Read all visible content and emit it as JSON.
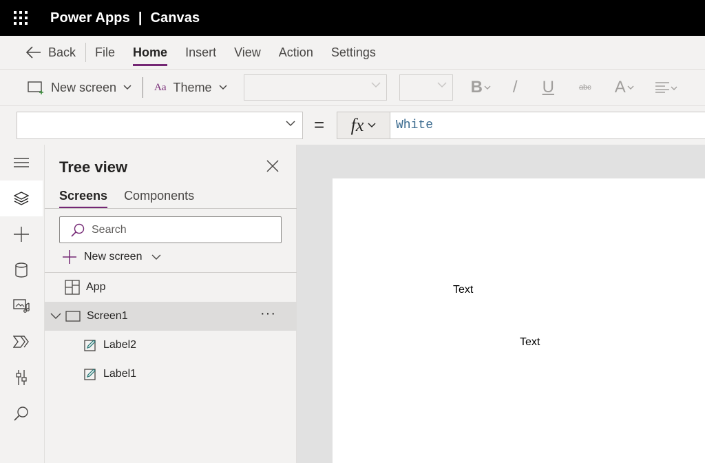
{
  "topbar": {
    "app_name": "Power Apps",
    "separator": "|",
    "app_type": "Canvas"
  },
  "menubar": {
    "back_label": "Back",
    "items": [
      {
        "label": "File",
        "active": false
      },
      {
        "label": "Home",
        "active": true
      },
      {
        "label": "Insert",
        "active": false
      },
      {
        "label": "View",
        "active": false
      },
      {
        "label": "Action",
        "active": false
      },
      {
        "label": "Settings",
        "active": false
      }
    ]
  },
  "ribbon": {
    "new_screen_label": "New screen",
    "theme_label": "Theme",
    "theme_icon_text": "Aa",
    "bold_glyph": "B",
    "italic_glyph": "/",
    "underline_glyph": "U",
    "strike_glyph": "abc",
    "fontcolor_glyph": "A"
  },
  "formulabar": {
    "property_value": "",
    "equals": "=",
    "fx_label": "fx",
    "formula": "White"
  },
  "treeview": {
    "title": "Tree view",
    "tabs": [
      {
        "label": "Screens",
        "active": true
      },
      {
        "label": "Components",
        "active": false
      }
    ],
    "search_placeholder": "Search",
    "new_screen_label": "New screen",
    "app_label": "App",
    "screen_label": "Screen1",
    "ellipsis": "···",
    "children": [
      {
        "label": "Label2"
      },
      {
        "label": "Label1"
      }
    ]
  },
  "canvas": {
    "label_top": "Text",
    "label_bottom": "Text"
  },
  "colors": {
    "accent": "#742774",
    "topbar_bg": "#000000",
    "chrome_bg": "#f3f2f1",
    "canvas_bg": "#e1e1e1",
    "formula_text": "#3a6a8e"
  }
}
